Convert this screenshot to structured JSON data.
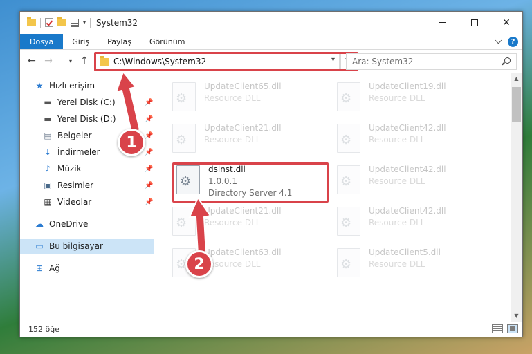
{
  "window": {
    "title": "System32"
  },
  "ribbon": {
    "tabs": [
      "Dosya",
      "Giriş",
      "Paylaş",
      "Görünüm"
    ]
  },
  "nav": {
    "address": "C:\\Windows\\System32",
    "search_placeholder": "Ara: System32"
  },
  "sidebar": {
    "items": [
      {
        "label": "Hızlı erişim",
        "icon": "star-icon"
      },
      {
        "label": "Yerel Disk (C:)",
        "icon": "drive-icon",
        "pinned": true
      },
      {
        "label": "Yerel Disk (D:)",
        "icon": "drive-icon",
        "pinned": true
      },
      {
        "label": "Belgeler",
        "icon": "document-icon",
        "pinned": true
      },
      {
        "label": "İndirmeler",
        "icon": "download-icon",
        "pinned": true
      },
      {
        "label": "Müzik",
        "icon": "music-icon",
        "pinned": true
      },
      {
        "label": "Resimler",
        "icon": "pictures-icon",
        "pinned": true
      },
      {
        "label": "Videolar",
        "icon": "video-icon",
        "pinned": true
      },
      {
        "label": "OneDrive",
        "icon": "cloud-icon"
      },
      {
        "label": "Bu bilgisayar",
        "icon": "computer-icon",
        "selected": true
      },
      {
        "label": "Ağ",
        "icon": "network-icon"
      }
    ]
  },
  "files": [
    {
      "name": "UpdateClient65.dll",
      "line2": "Resource DLL",
      "line3": "",
      "dimmed": true
    },
    {
      "name": "UpdateClient19.dll",
      "line2": "Resource DLL",
      "line3": "",
      "dimmed": true
    },
    {
      "name": "UpdateClient21.dll",
      "line2": "Resource DLL",
      "line3": "",
      "dimmed": true
    },
    {
      "name": "UpdateClient42.dll",
      "line2": "Resource DLL",
      "line3": "",
      "dimmed": true
    },
    {
      "name": "dsinst.dll",
      "line2": "1.0.0.1",
      "line3": "Directory Server 4.1",
      "dimmed": false
    },
    {
      "name": "UpdateClient42.dll",
      "line2": "Resource DLL",
      "line3": "",
      "dimmed": true
    },
    {
      "name": "UpdateClient21.dll",
      "line2": "Resource DLL",
      "line3": "",
      "dimmed": true
    },
    {
      "name": "UpdateClient42.dll",
      "line2": "Resource DLL",
      "line3": "",
      "dimmed": true
    },
    {
      "name": "UpdateClient63.dll",
      "line2": "Resource DLL",
      "line3": "",
      "dimmed": true
    },
    {
      "name": "UpdateClient5.dll",
      "line2": "Resource DLL",
      "line3": "",
      "dimmed": true
    }
  ],
  "status": {
    "item_count": "152 öğe"
  },
  "steps": [
    "1",
    "2"
  ],
  "colors": {
    "accent": "#1979ca",
    "highlight": "#d9434a",
    "selection": "#cce4f7"
  }
}
